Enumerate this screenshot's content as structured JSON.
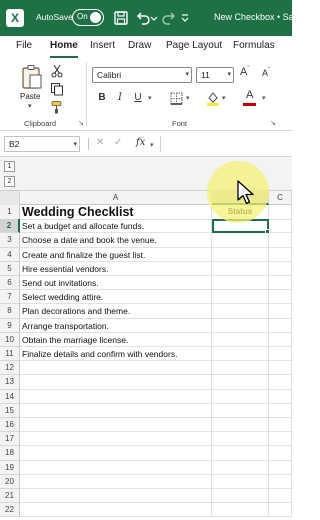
{
  "titlebar": {
    "logo": "X",
    "autosave_label": "AutoSave",
    "autosave_state": "On",
    "title": "New Checkbox • Sa",
    "icons": [
      "excel-logo-icon",
      "save-icon",
      "undo-icon",
      "redo-icon"
    ]
  },
  "tabs": [
    "File",
    "Home",
    "Insert",
    "Draw",
    "Page Layout",
    "Formulas"
  ],
  "ribbon": {
    "paste_label": "Paste",
    "clipboard_label": "Clipboard",
    "font_name": "Calibri",
    "font_size": "11",
    "font_group_label": "Font",
    "bold": "B",
    "italic": "I",
    "underline": "U",
    "font_color_letter": "A"
  },
  "formula_bar": {
    "name_box": "B2",
    "fx": "fx",
    "formula": ""
  },
  "outline_levels": [
    "1",
    "2"
  ],
  "columns": [
    "A",
    "B",
    "C"
  ],
  "sheet": {
    "title": "Wedding Checklist",
    "status_header": "Status",
    "tasks": [
      "Set a budget and allocate funds.",
      "Choose a date and book the venue.",
      "Create and finalize the guest list.",
      "Hire essential vendors.",
      "Send out invitations.",
      "Select wedding attire.",
      "Plan decorations and theme.",
      "Arrange transportation.",
      "Obtain the marriage license.",
      "Finalize details and confirm with vendors."
    ],
    "row_numbers": [
      "1",
      "2",
      "3",
      "4",
      "5",
      "6",
      "7",
      "8",
      "9",
      "10",
      "11",
      "12",
      "13",
      "14",
      "15",
      "16",
      "17",
      "18",
      "19",
      "20",
      "21",
      "22"
    ],
    "active_cell": "B2"
  },
  "colors": {
    "brand_green": "#1e7145",
    "highlight_yellow": "#f6f078",
    "font_color_red": "#c00000"
  }
}
